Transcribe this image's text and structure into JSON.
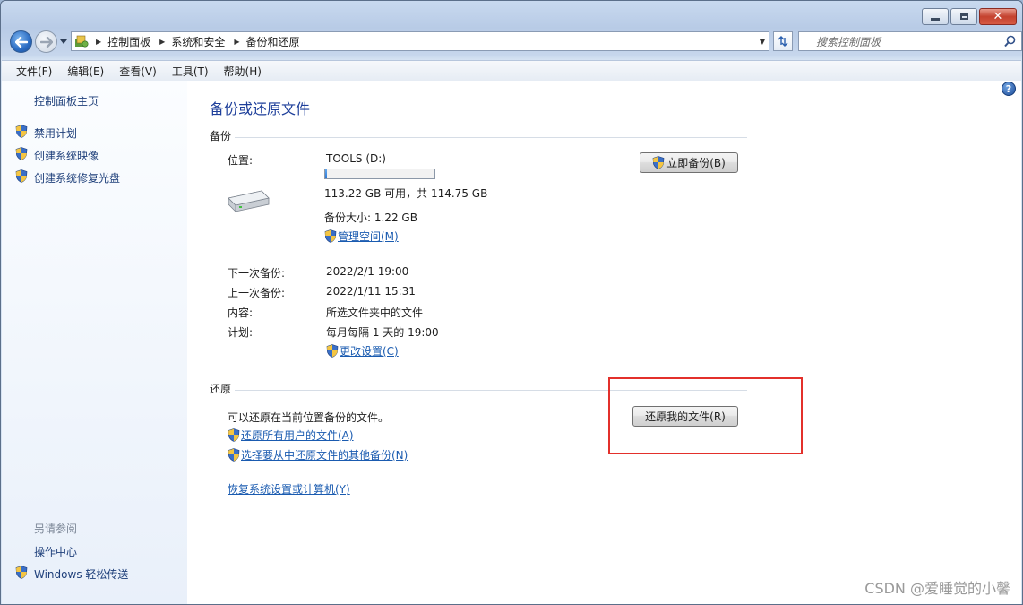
{
  "address_bar": {
    "breadcrumbs": [
      "控制面板",
      "系统和安全",
      "备份和还原"
    ],
    "search_placeholder": "搜索控制面板"
  },
  "menu": {
    "items": [
      "文件(F)",
      "编辑(E)",
      "查看(V)",
      "工具(T)",
      "帮助(H)"
    ]
  },
  "left_pane": {
    "home_link": "控制面板主页",
    "tasks": [
      "禁用计划",
      "创建系统映像",
      "创建系统修复光盘"
    ],
    "see_also_heading": "另请参阅",
    "see_also": [
      "操作中心",
      "Windows 轻松传送"
    ]
  },
  "main": {
    "title": "备份或还原文件",
    "backup": {
      "heading": "备份",
      "location_label": "位置:",
      "location_value": "TOOLS (D:)",
      "usage_fraction": 0.013,
      "space_text": "113.22 GB 可用，共 114.75 GB",
      "size_text": "备份大小: 1.22 GB",
      "manage_space_link": "管理空间(M)",
      "backup_now_button": "立即备份(B)",
      "next_backup_label": "下一次备份:",
      "next_backup_value": "2022/2/1 19:00",
      "last_backup_label": "上一次备份:",
      "last_backup_value": "2022/1/11 15:31",
      "content_label": "内容:",
      "content_value": "所选文件夹中的文件",
      "schedule_label": "计划:",
      "schedule_value": "每月每隔 1 天的 19:00",
      "change_settings_link": "更改设置(C)"
    },
    "restore": {
      "heading": "还原",
      "description": "可以还原在当前位置备份的文件。",
      "restore_my_files_button": "还原我的文件(R)",
      "restore_all_users_link": "还原所有用户的文件(A)",
      "select_other_backup_link": "选择要从中还原文件的其他备份(N)",
      "recover_system_link": "恢复系统设置或计算机(Y)"
    }
  },
  "watermark": "CSDN @爱睡觉的小馨",
  "colors": {
    "highlight_box": "#e3302b",
    "link": "#1a5bb0",
    "title": "#1e3f9a"
  }
}
